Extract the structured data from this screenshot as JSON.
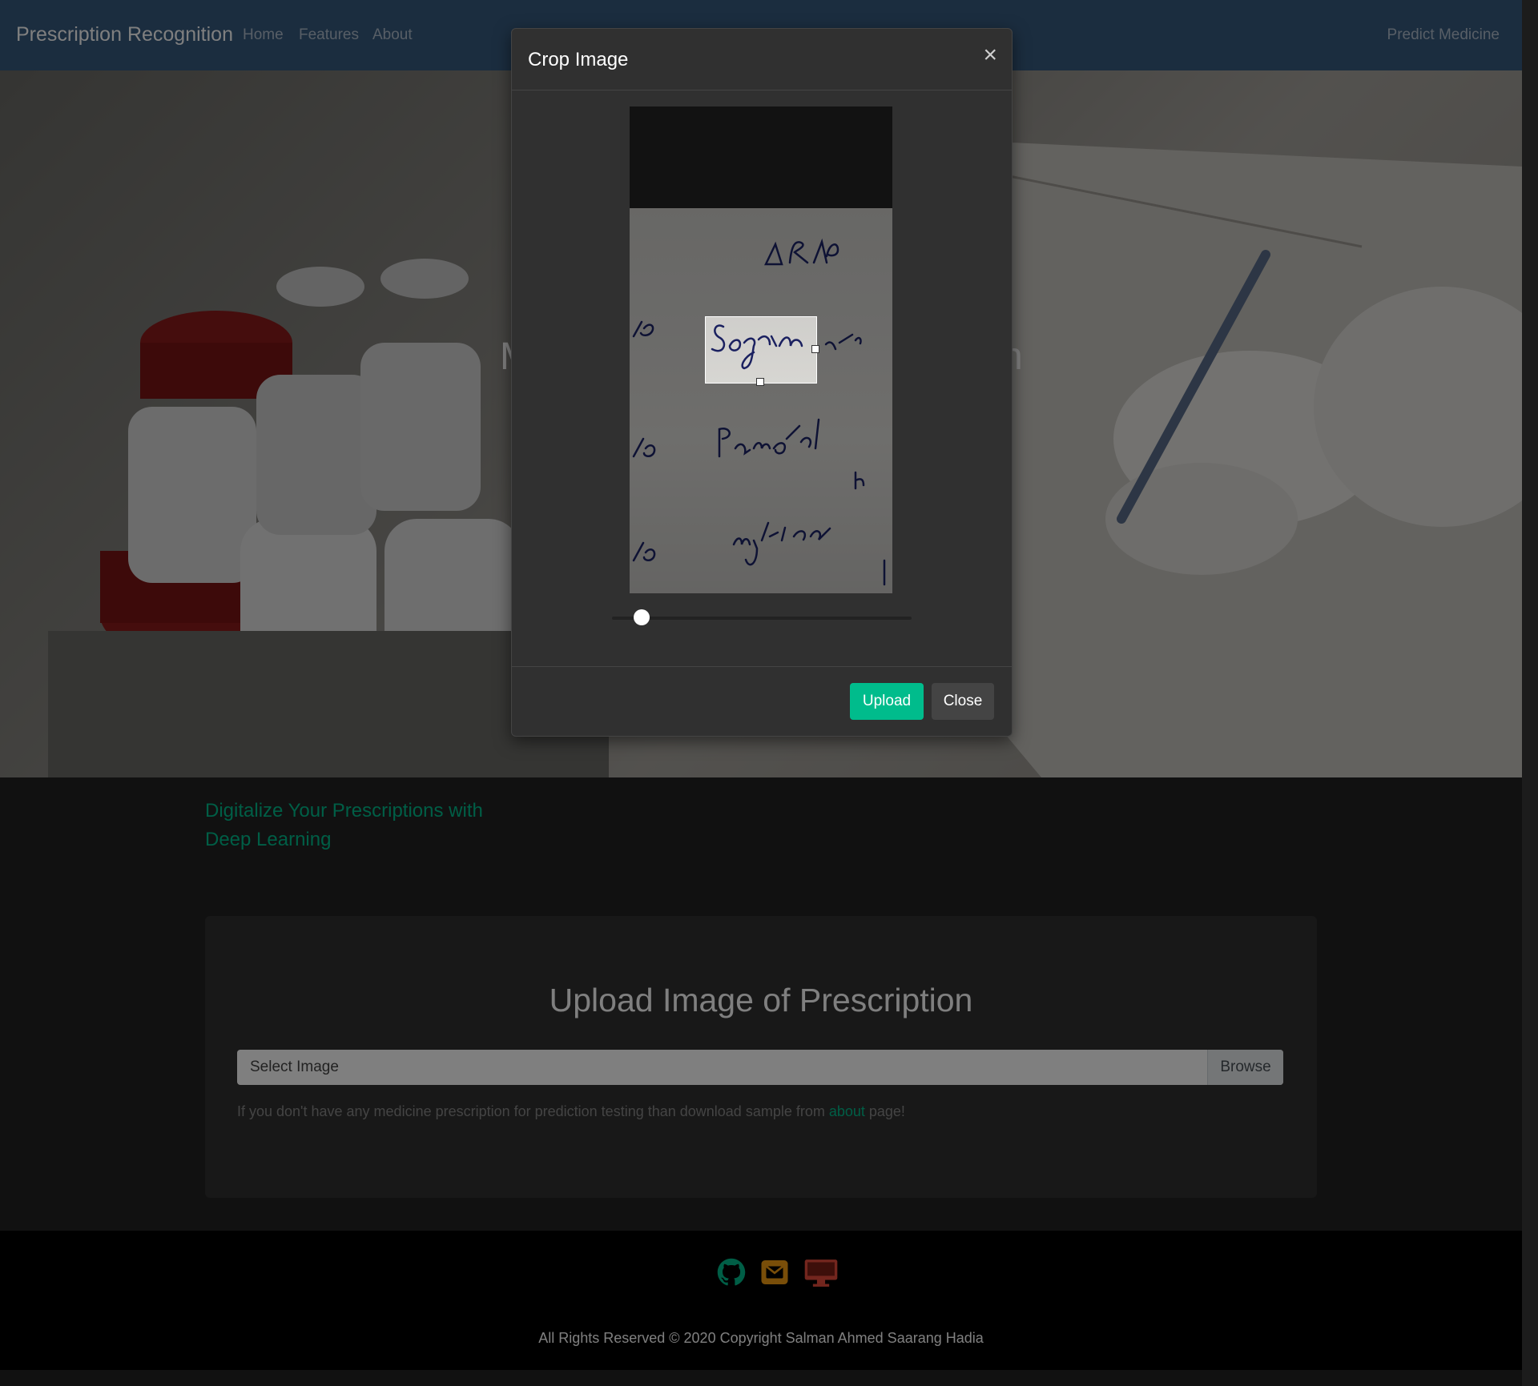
{
  "navbar": {
    "brand": "Prescription Recognition",
    "links": [
      "Home",
      "Features",
      "About"
    ],
    "right_link": "Predict Medicine"
  },
  "hero": {
    "partial_heading_left": "M",
    "partial_heading_right": "n"
  },
  "tagline": {
    "line1": "Digitalize Your Prescriptions with",
    "line2": "Deep Learning"
  },
  "upload_card": {
    "title": "Upload Image of Prescription",
    "file_label": "Select Image",
    "browse_label": "Browse",
    "help_prefix": "If you don't have any medicine prescription for prediction testing than download sample from ",
    "help_link": "about",
    "help_suffix": " page!"
  },
  "footer": {
    "icons": [
      "github-icon",
      "envelope-icon",
      "desktop-icon"
    ],
    "icon_colors": [
      "#00bc8c",
      "#f39c12",
      "#e74c3c"
    ],
    "copyright": "All Rights Reserved © 2020 Copyright Salman Ahmed Saarang Hadia"
  },
  "crop_modal": {
    "title": "Crop Image",
    "close_symbol": "×",
    "zoom_level": 0.1,
    "upload_label": "Upload",
    "close_label": "Close"
  },
  "colors": {
    "navbar": "#375a7f",
    "accent": "#00bc8c",
    "modal_bg": "#303030"
  }
}
